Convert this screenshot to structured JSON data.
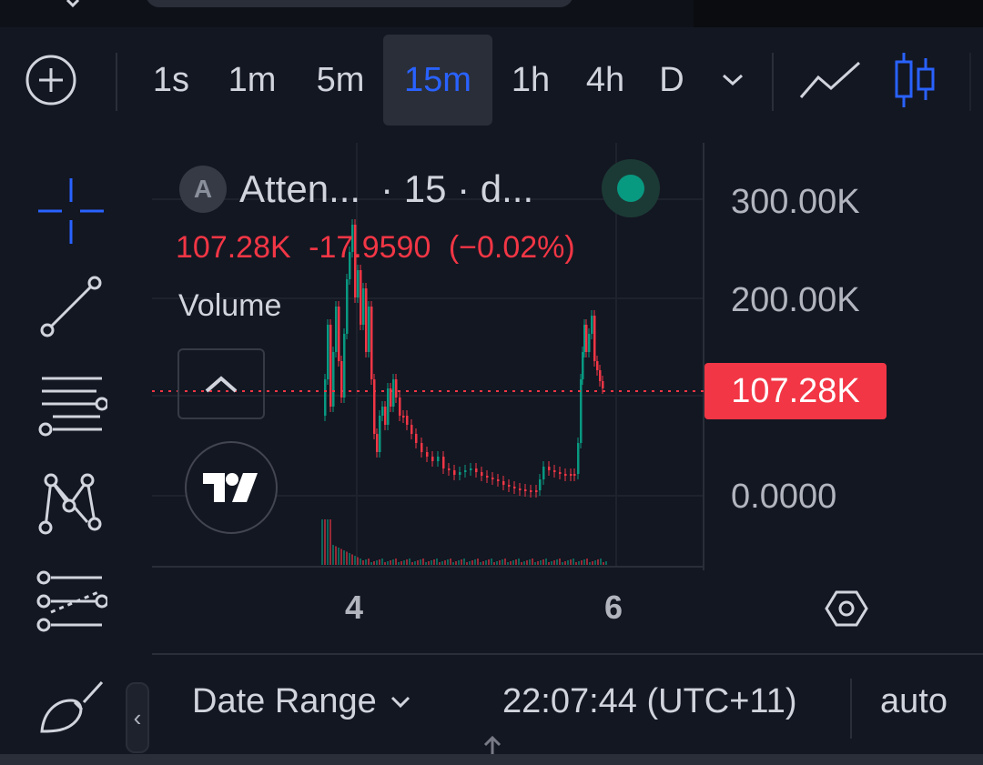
{
  "toolbar": {
    "intervals": [
      "1s",
      "1m",
      "5m",
      "15m",
      "1h",
      "4h",
      "D"
    ],
    "active_interval": "15m",
    "accent_color": "#2962ff"
  },
  "legend": {
    "symbol_icon_letter": "A",
    "title": "Atten...",
    "meta": "· 15 · d...",
    "last": "107.28K",
    "change": "-17.9590",
    "change_pct": "(−0.02%)",
    "volume_label": "Volume",
    "down_color": "#f23645",
    "up_color": "#089981"
  },
  "price_axis": {
    "labels": [
      "300.00K",
      "200.00K",
      "0.0000"
    ],
    "last_price_tag": "107.28K"
  },
  "time_axis": {
    "labels": [
      "4",
      "6"
    ]
  },
  "bottom_bar": {
    "date_range_label": "Date Range",
    "clock": "22:07:44 (UTC+11)",
    "scale_mode": "auto"
  },
  "icons": {
    "toolbar": [
      "add-icon",
      "line-chart-icon",
      "candles-icon",
      "chevron-down-icon"
    ],
    "left_tools": [
      "crosshair-icon",
      "trend-line-icon",
      "fib-retracement-icon",
      "pattern-icon",
      "prediction-icon",
      "brush-icon"
    ],
    "chart": [
      "gear-icon",
      "tradingview-logo-icon",
      "live-status-icon"
    ]
  }
}
